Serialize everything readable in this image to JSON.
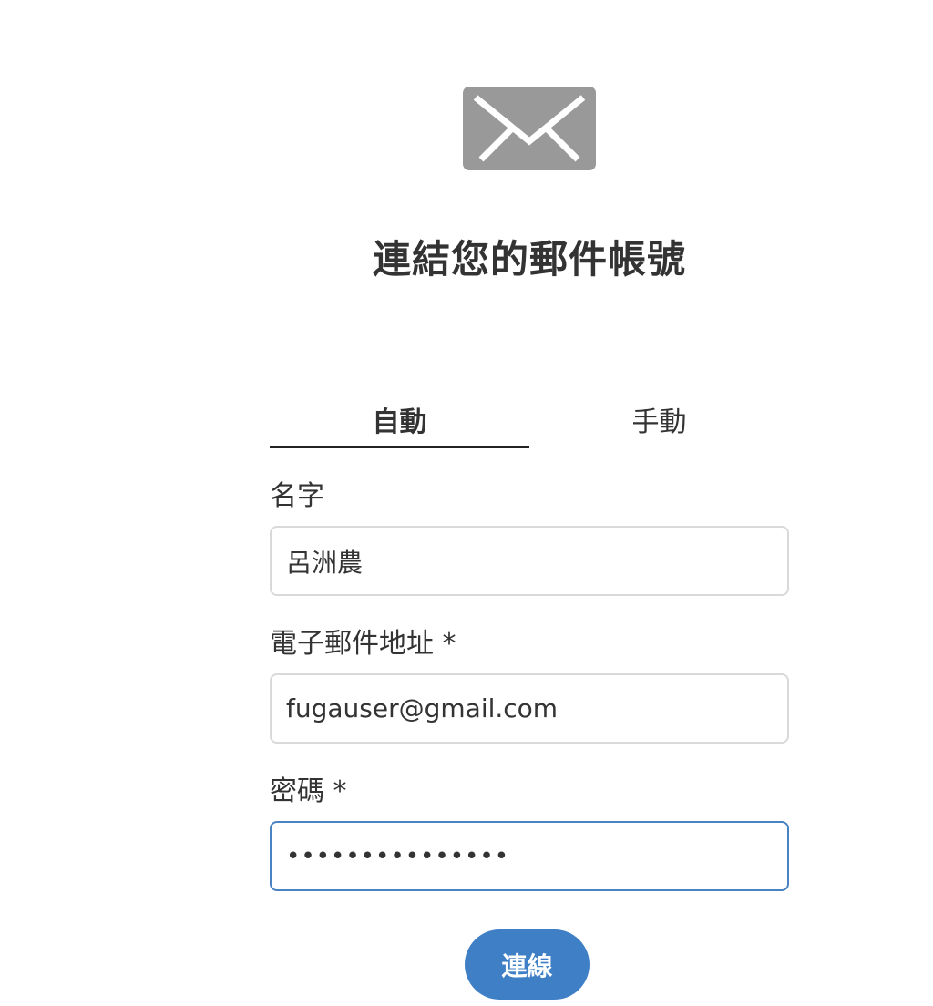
{
  "header": {
    "title": "連結您的郵件帳號",
    "icon": "mail-envelope-icon"
  },
  "tabs": [
    {
      "label": "自動",
      "selected": true
    },
    {
      "label": "手動",
      "selected": false
    }
  ],
  "form": {
    "name": {
      "label": "名字",
      "value": "呂洲農"
    },
    "email": {
      "label": "電子郵件地址 *",
      "value": "fugauser@gmail.com"
    },
    "password": {
      "label": "密碼 *",
      "value": "•••••••••••••••"
    }
  },
  "actions": {
    "connect_label": "連線"
  },
  "colors": {
    "accent": "#3f7fc6",
    "icon": "#999999",
    "text": "#333333",
    "border": "#d9d9d9",
    "focus_border": "#4a83c4"
  }
}
